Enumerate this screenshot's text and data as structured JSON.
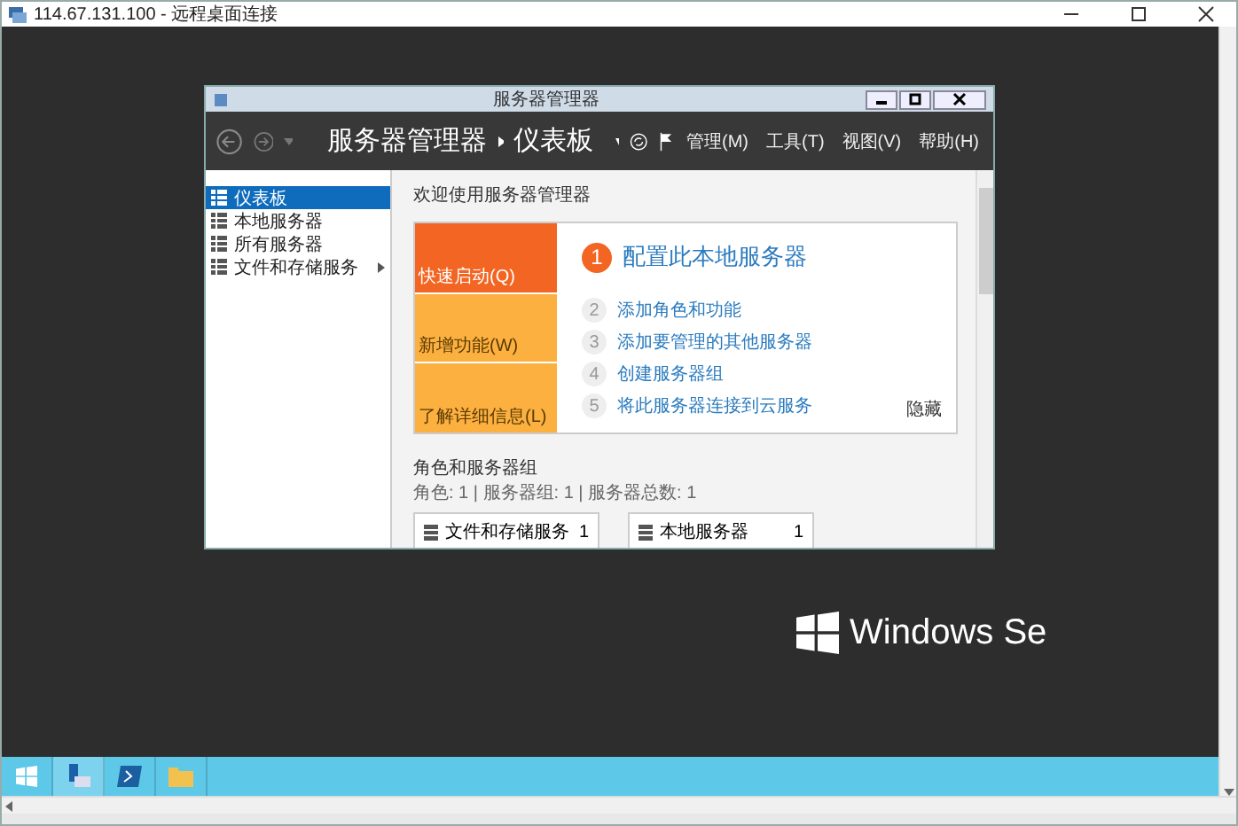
{
  "window": {
    "title": "114.67.131.100 - 远程桌面连接"
  },
  "server_manager": {
    "title": "服务器管理器",
    "breadcrumb": {
      "root": "服务器管理器",
      "current": "仪表板"
    },
    "menus": [
      "管理(M)",
      "工具(T)",
      "视图(V)",
      "帮助(H)"
    ],
    "sidebar": {
      "items": [
        {
          "label": "仪表板",
          "selected": true,
          "has_submenu": false
        },
        {
          "label": "本地服务器",
          "selected": false,
          "has_submenu": false
        },
        {
          "label": "所有服务器",
          "selected": false,
          "has_submenu": false
        },
        {
          "label": "文件和存储服务",
          "selected": false,
          "has_submenu": true
        }
      ]
    },
    "welcome": "欢迎使用服务器管理器",
    "quick_start": {
      "tiles": [
        {
          "label": "快速启动(Q)",
          "selected": true
        },
        {
          "label": "新增功能(W)",
          "selected": false
        },
        {
          "label": "了解详细信息(L)",
          "selected": false
        }
      ],
      "steps": [
        {
          "number": "1",
          "label": "配置此本地服务器",
          "kind": "primary"
        },
        {
          "number": "2",
          "label": "添加角色和功能",
          "kind": "secondary"
        },
        {
          "number": "3",
          "label": "添加要管理的其他服务器",
          "kind": "secondary"
        },
        {
          "number": "4",
          "label": "创建服务器组",
          "kind": "secondary"
        },
        {
          "number": "5",
          "label": "将此服务器连接到云服务",
          "kind": "secondary"
        }
      ],
      "hide": "隐藏"
    },
    "roles": {
      "title": "角色和服务器组",
      "summary": "角色: 1 | 服务器组: 1 | 服务器总数: 1",
      "cards": [
        {
          "name": "文件和存储服务",
          "count": "1"
        },
        {
          "name": "本地服务器",
          "count": "1"
        }
      ]
    }
  },
  "desktop": {
    "logo_text": "Windows Se"
  }
}
